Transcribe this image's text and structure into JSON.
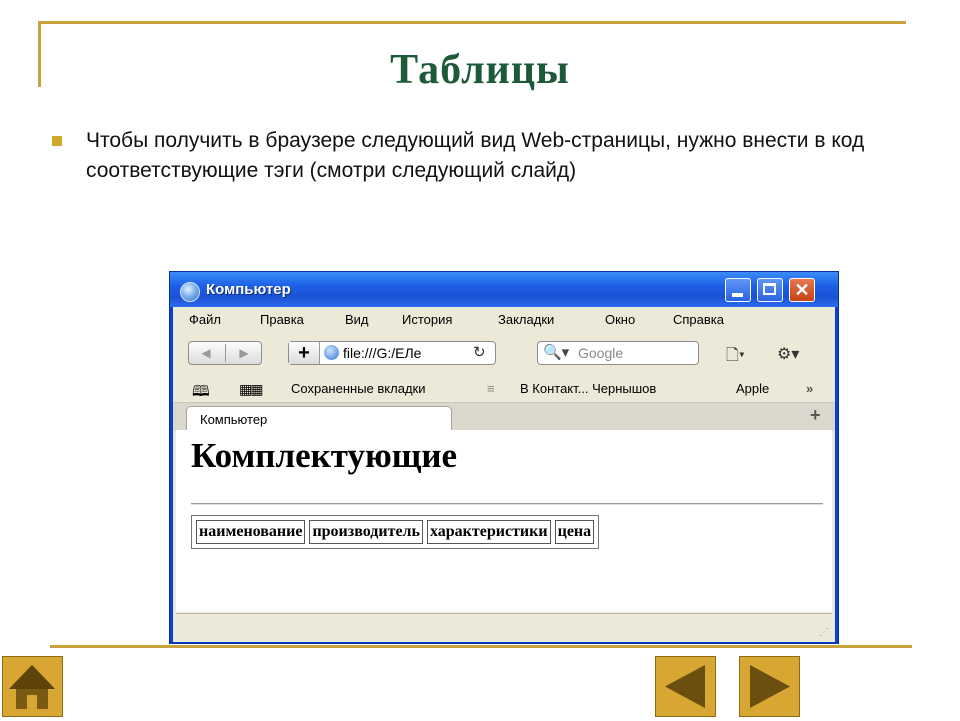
{
  "slide": {
    "title": "Таблицы",
    "bullet_text": "Чтобы получить в браузере следующий вид Web-страницы, нужно внести в код соответствующие тэги (смотри следующий слайд)"
  },
  "browser": {
    "window_title": "Компьютер",
    "menu": [
      "Файл",
      "Правка",
      "Вид",
      "История",
      "Закладки",
      "Окно",
      "Справка"
    ],
    "address_value": "file:///G:/ЕЛе",
    "search_placeholder": "Google",
    "bookmarks": [
      "Сохраненные вкладки",
      "В Контакт... Чернышов",
      "Apple"
    ],
    "tab_label": "Компьютер",
    "page": {
      "heading": "Комплектующие",
      "table_headers": [
        "наименование",
        "производитель",
        "характеристики",
        "цена"
      ]
    }
  },
  "nav_buttons": [
    "home-button",
    "previous-slide-button",
    "next-slide-button"
  ],
  "colors": {
    "accent_gold": "#c9a13d",
    "title_green": "#1d5a3a",
    "nav_button": "#d7a633",
    "xp_titlebar": "#1d5fe6"
  }
}
